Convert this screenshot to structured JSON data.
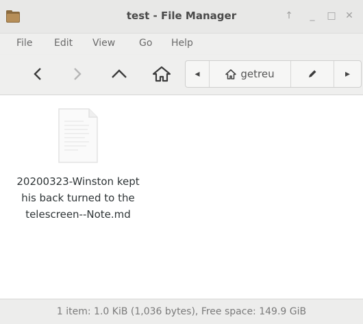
{
  "window": {
    "title": "test - File Manager",
    "controls": {
      "up": "↑",
      "minimize": "_",
      "maximize": "□",
      "close": "✕"
    }
  },
  "menu": {
    "items": [
      {
        "label": "File"
      },
      {
        "label": "Edit"
      },
      {
        "label": "View"
      },
      {
        "label": "Go"
      },
      {
        "label": "Help"
      }
    ]
  },
  "toolbar": {
    "back_icon": "chevron-left-icon",
    "forward_icon": "chevron-right-icon",
    "up_icon": "chevron-up-icon",
    "home_icon": "home-icon"
  },
  "pathbar": {
    "left_arrow": "◂",
    "segment_label": "getreu",
    "right_arrow": "▸",
    "edit_icon": "pencil-icon"
  },
  "content": {
    "files": [
      {
        "name": "20200323-Winston kept his back turned to the telescreen--Note.md",
        "icon": "text-file-icon"
      }
    ]
  },
  "status": {
    "text": "1 item: 1.0 KiB (1,036 bytes), Free space: 149.9 GiB"
  },
  "colors": {
    "content_bg": "#ffffff",
    "chrome_bg": "#ededec",
    "folder_icon": "#a07a4a"
  }
}
